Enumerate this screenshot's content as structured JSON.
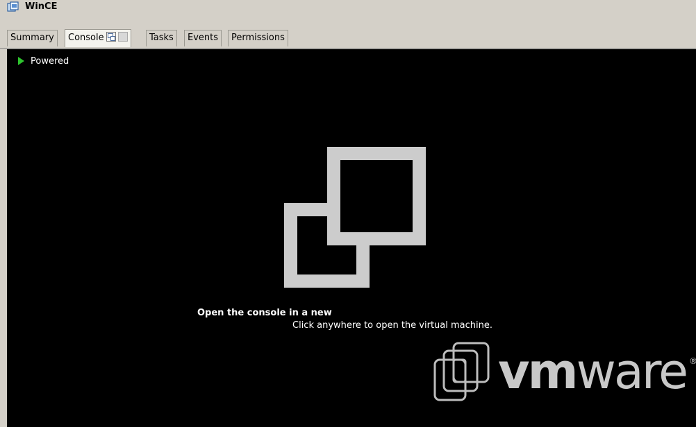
{
  "window": {
    "title": "WinCE",
    "icon": "virtual-machine-icon"
  },
  "tabs": [
    {
      "label": "Summary",
      "active": false
    },
    {
      "label": "Console",
      "active": true
    },
    {
      "label": "Tasks",
      "active": false
    },
    {
      "label": "Events",
      "active": false
    },
    {
      "label": "Permissions",
      "active": false
    }
  ],
  "console": {
    "status_label": "Powered",
    "status_icon": "play-icon",
    "status_color": "#2ec32e",
    "heading": "Open the console in a new",
    "hint": "Click anywhere to open the virtual machine.",
    "background_color": "#000000",
    "icon_color": "#cccccc"
  },
  "branding": {
    "logo_text_bold": "vm",
    "logo_text_regular": "ware",
    "logo_mark": "®",
    "logo_color": "#c8c8c8"
  }
}
